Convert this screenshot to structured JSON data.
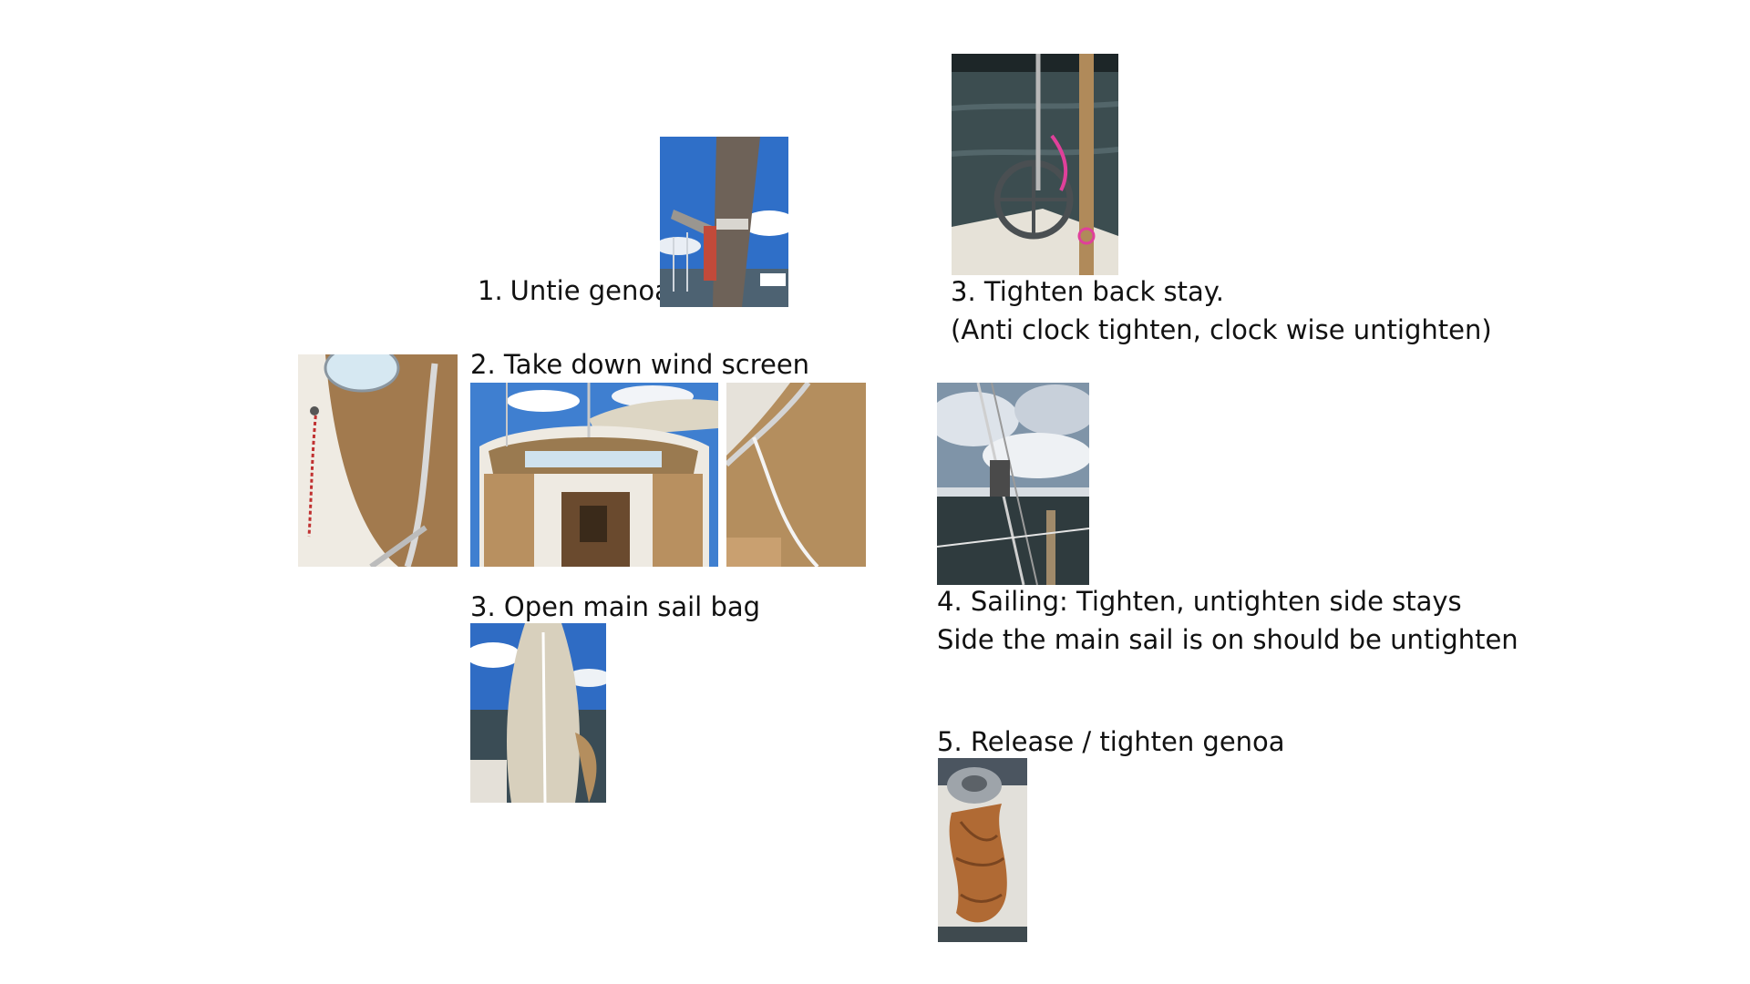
{
  "steps": {
    "untie_genoa": {
      "number": "1.",
      "text": "Untie genoa"
    },
    "wind_screen": {
      "text": "2. Take down wind screen"
    },
    "main_sail_bag": {
      "text": "3. Open main sail bag"
    },
    "back_stay": {
      "line1": "3. Tighten back stay.",
      "line2": "(Anti clock tighten, clock wise untighten)"
    },
    "side_stays": {
      "line1": "4. Sailing: Tighten, untighten side stays",
      "line2": "Side the main sail is on should be untighten"
    },
    "release_genoa": {
      "text": "5. Release / tighten genoa"
    }
  },
  "colors": {
    "sky": "#2f6fc8",
    "canvas_tan": "#b08858",
    "hull_white": "#e8e4dc",
    "water": "#34454a",
    "rope_orange": "#b86a30"
  }
}
